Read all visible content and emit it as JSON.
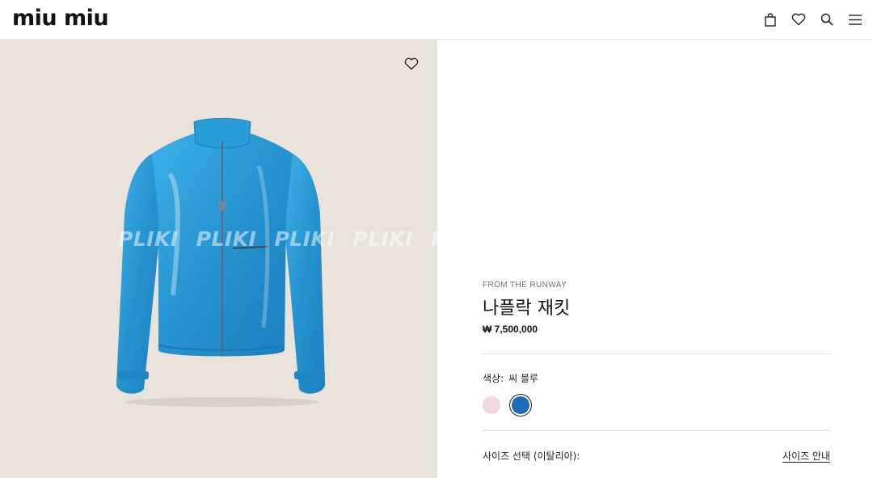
{
  "header": {
    "logo": "miu miu",
    "icons": [
      "bag-icon",
      "heart-icon",
      "search-icon",
      "menu-icon"
    ]
  },
  "image": {
    "watermark": [
      "PLIKI",
      "PLIKI",
      "PLIKI",
      "PLIKI",
      "PLIKI"
    ],
    "wishlist_icon": "heart-icon"
  },
  "product": {
    "label": "FROM THE RUNWAY",
    "name": "나플락 재킷",
    "price": "₩ 7,500,000",
    "color_label": "색상:",
    "color_value": "씨 블루",
    "swatches": [
      {
        "name": "pink",
        "color": "#f2d9df",
        "selected": false
      },
      {
        "name": "blue",
        "color": "#1e6cb8",
        "selected": true
      }
    ],
    "size_label": "사이즈 선택 (이탈리아):",
    "size_guide": "사이즈 안내"
  },
  "colors": {
    "image_bg": "#e9e3db",
    "jacket": "#2b9bd4"
  }
}
